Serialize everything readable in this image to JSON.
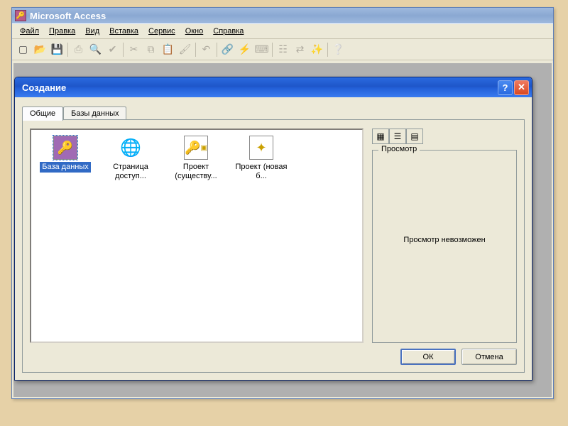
{
  "app": {
    "title": "Microsoft Access"
  },
  "menubar": {
    "file": "Файл",
    "edit": "Правка",
    "view": "Вид",
    "insert": "Вставка",
    "service": "Сервис",
    "window": "Окно",
    "help": "Справка"
  },
  "toolbar_icons": {
    "new": "new-file-icon",
    "open": "open-folder-icon",
    "save": "save-icon",
    "print": "print-icon",
    "printpreview": "print-preview-icon",
    "spell": "spellcheck-icon",
    "cut": "cut-icon",
    "copy": "copy-icon",
    "paste": "paste-icon",
    "undo": "undo-icon",
    "links": "links-icon",
    "analysis": "analysis-icon",
    "code": "code-icon",
    "props": "properties-icon",
    "relations": "relations-icon",
    "newobj": "new-object-icon",
    "help": "help-icon"
  },
  "dialog": {
    "title": "Создание",
    "tabs": {
      "general": "Общие",
      "databases": "Базы данных"
    },
    "items": [
      {
        "label": "База данных",
        "icon": "database-icon",
        "selected": true
      },
      {
        "label": "Страница доступ...",
        "icon": "data-access-page-icon",
        "selected": false
      },
      {
        "label": "Проект (существу...",
        "icon": "project-existing-icon",
        "selected": false
      },
      {
        "label": "Проект (новая б...",
        "icon": "project-new-icon",
        "selected": false
      }
    ],
    "view_modes": {
      "large": "large-icons",
      "list": "list",
      "details": "details"
    },
    "preview": {
      "legend": "Просмотр",
      "message": "Просмотр невозможен"
    },
    "buttons": {
      "ok": "ОК",
      "cancel": "Отмена"
    }
  }
}
